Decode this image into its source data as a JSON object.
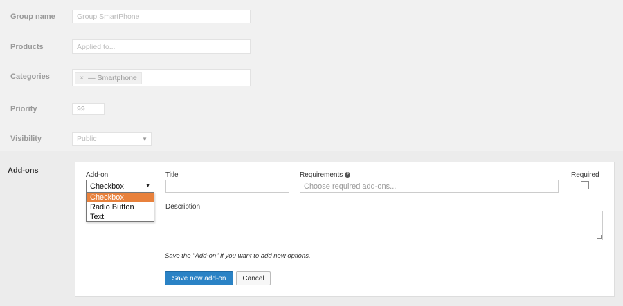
{
  "form": {
    "group_name": {
      "label": "Group name",
      "placeholder": "Group SmartPhone"
    },
    "products": {
      "label": "Products",
      "placeholder": "Applied to..."
    },
    "categories": {
      "label": "Categories",
      "tag_remove": "×",
      "tag_label": "— Smartphone"
    },
    "priority": {
      "label": "Priority",
      "value": "99"
    },
    "visibility": {
      "label": "Visibility",
      "value": "Public",
      "arrow": "▼"
    }
  },
  "addons": {
    "section_label": "Add-ons",
    "addon": {
      "label": "Add-on",
      "selected": "Checkbox",
      "arrow": "▼",
      "options": [
        "Checkbox",
        "Radio Button",
        "Text"
      ]
    },
    "title": {
      "label": "Title",
      "value": ""
    },
    "requirements": {
      "label": "Requirements",
      "help_icon": "?",
      "placeholder": "Choose required add-ons..."
    },
    "required": {
      "label": "Required",
      "checked": false
    },
    "description": {
      "label": "Description",
      "value": ""
    },
    "note": "Save the \"Add-on\" if you want to add new options.",
    "save_button": "Save new add-on",
    "cancel_button": "Cancel"
  }
}
